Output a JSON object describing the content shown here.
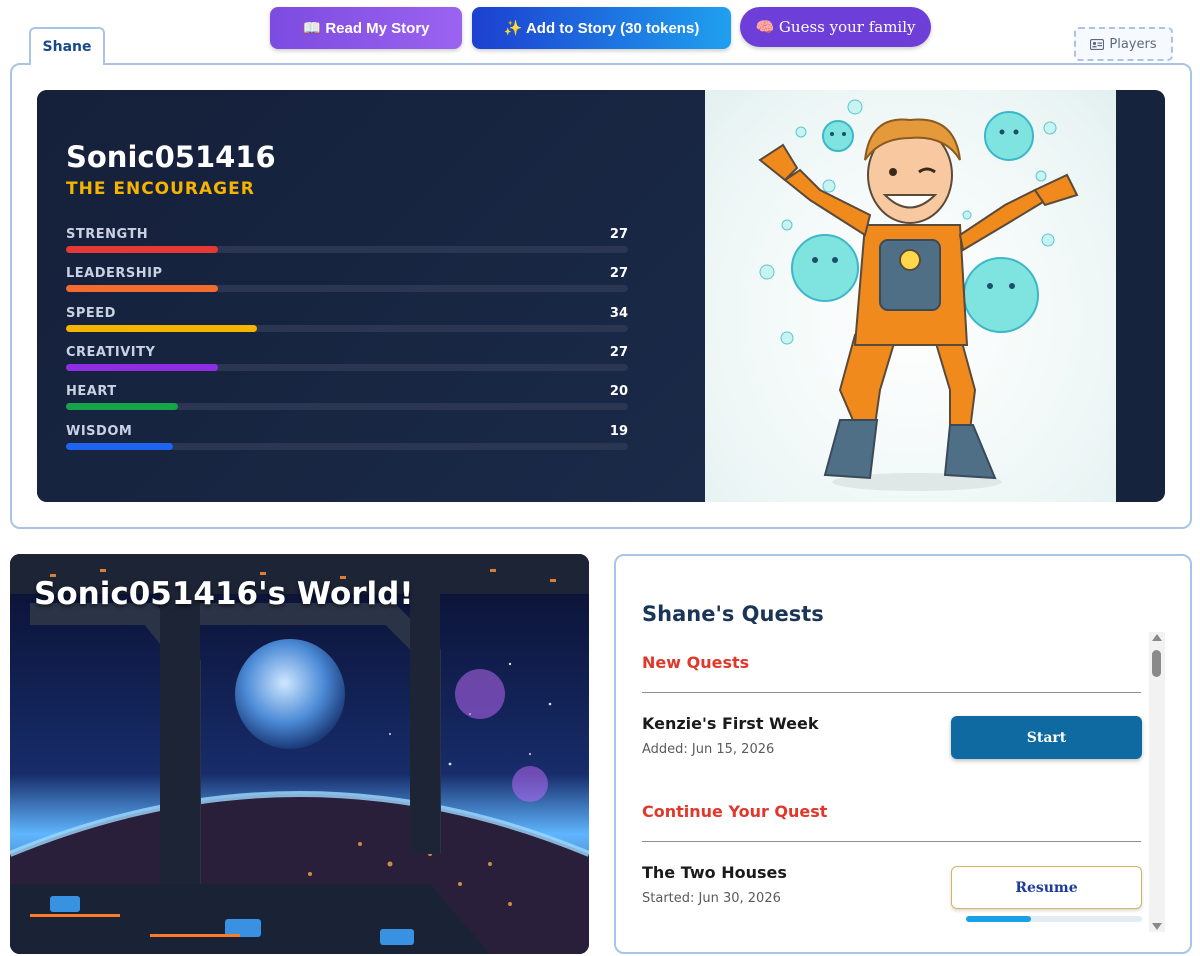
{
  "toolbar": {
    "read_label": "📖 Read My Story",
    "add_label": "✨ Add to Story (30 tokens)",
    "guess_label": "🧠 Guess your family"
  },
  "tabs": [
    {
      "label": "Shane"
    }
  ],
  "players": {
    "label": "Players",
    "icon": "id-card-icon"
  },
  "character": {
    "name": "Sonic051416",
    "title": "THE ENCOURAGER",
    "stats": [
      {
        "label": "STRENGTH",
        "value": 27,
        "color": "#e53935"
      },
      {
        "label": "LEADERSHIP",
        "value": 27,
        "color": "#f26b2f"
      },
      {
        "label": "SPEED",
        "value": 34,
        "color": "#f5b400"
      },
      {
        "label": "CREATIVITY",
        "value": 27,
        "color": "#8e2de2"
      },
      {
        "label": "HEART",
        "value": 20,
        "color": "#16a34a"
      },
      {
        "label": "WISDOM",
        "value": 19,
        "color": "#1f64f0"
      }
    ],
    "stat_max": 100
  },
  "world": {
    "title": "Sonic051416's World!"
  },
  "quests": {
    "heading": "Shane's Quests",
    "new_section": "New Quests",
    "new_items": [
      {
        "title": "Kenzie's First Week",
        "date_label": "Added:  Jun 15, 2026",
        "action": "Start"
      }
    ],
    "continue_section": "Continue Your Quest",
    "continue_items": [
      {
        "title": "The Two Houses",
        "date_label": "Started:  Jun 30, 2026",
        "action": "Resume",
        "progress": 0.37
      }
    ]
  }
}
